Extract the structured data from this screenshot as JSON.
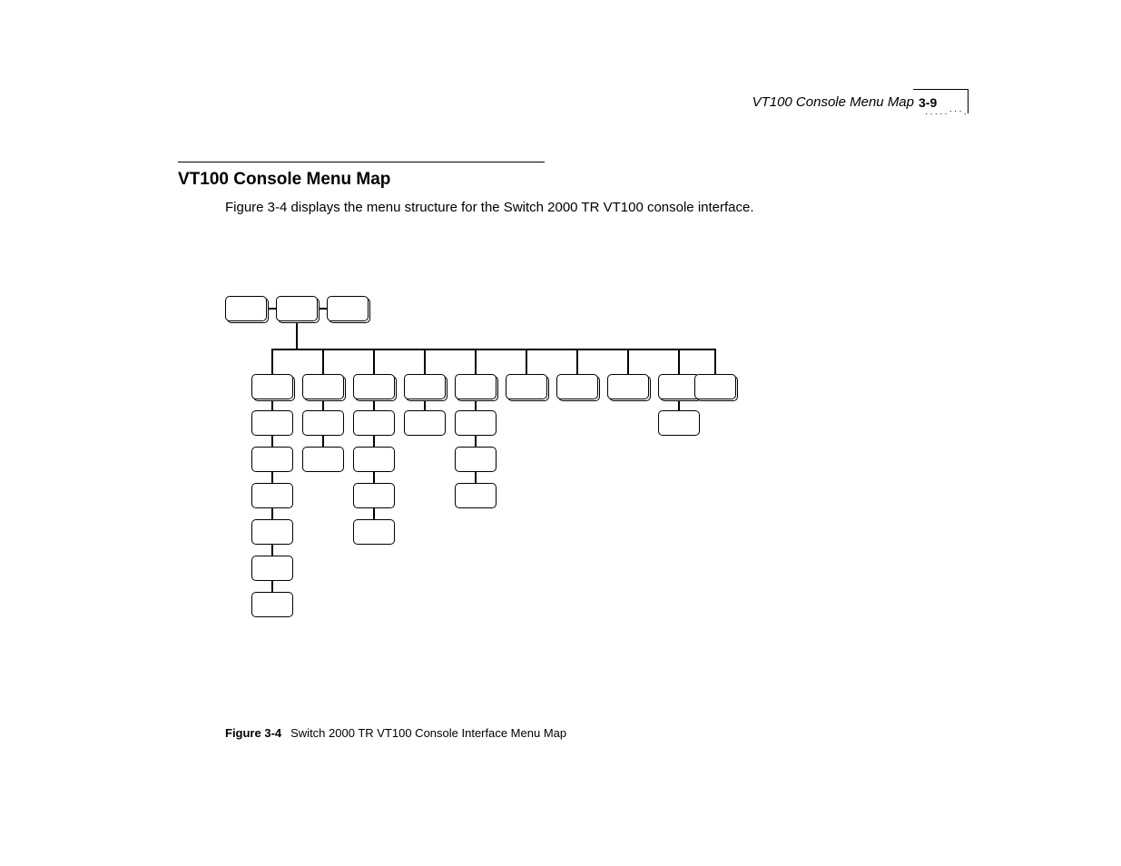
{
  "header": {
    "running_title": "VT100 Console Menu Map",
    "page_number": "3-9"
  },
  "section": {
    "title": "VT100 Console Menu Map",
    "intro": "Figure 3-4 displays the menu structure for the Switch 2000 TR VT100 console interface."
  },
  "figure": {
    "label": "Figure 3-4",
    "caption": "Switch 2000 TR VT100 Console Interface Menu Map"
  }
}
